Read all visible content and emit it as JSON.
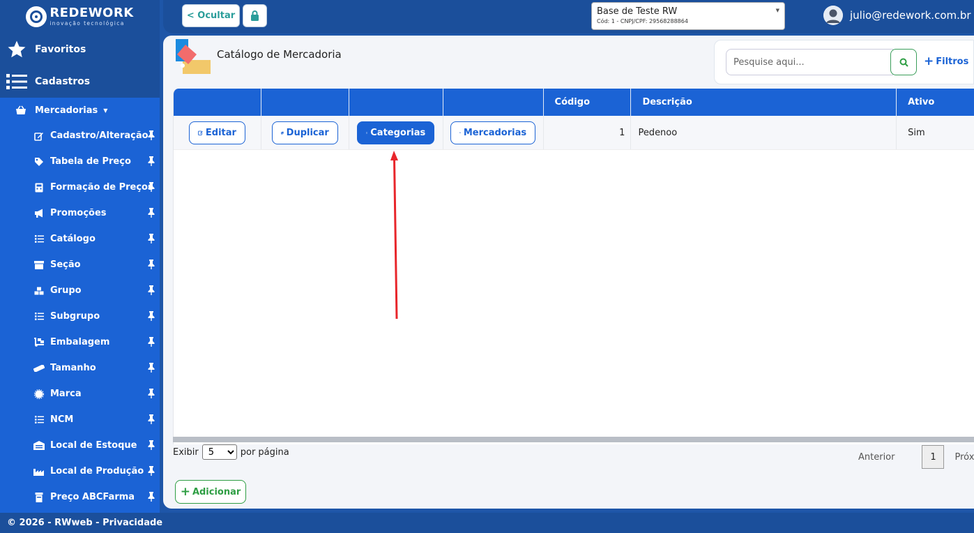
{
  "brand": {
    "name": "REDEWORK",
    "tagline": "inovação tecnológica"
  },
  "sidebar": {
    "main": [
      {
        "label": "Favoritos",
        "icon": "star-icon"
      },
      {
        "label": "Cadastros",
        "icon": "list-icon"
      }
    ],
    "group": {
      "label": "Mercadorias",
      "icon": "basket-icon"
    },
    "items": [
      {
        "label": "Cadastro/Alteração",
        "icon": "edit-icon"
      },
      {
        "label": "Tabela de Preço",
        "icon": "tag-icon"
      },
      {
        "label": "Formação de Preços",
        "icon": "calculator-icon"
      },
      {
        "label": "Promoções",
        "icon": "megaphone-icon"
      },
      {
        "label": "Catálogo",
        "icon": "list-icon"
      },
      {
        "label": "Seção",
        "icon": "archive-icon"
      },
      {
        "label": "Grupo",
        "icon": "cubes-icon"
      },
      {
        "label": "Subgrupo",
        "icon": "list-icon"
      },
      {
        "label": "Embalagem",
        "icon": "dolly-icon"
      },
      {
        "label": "Tamanho",
        "icon": "ruler-icon"
      },
      {
        "label": "Marca",
        "icon": "badge-icon"
      },
      {
        "label": "NCM",
        "icon": "list-icon"
      },
      {
        "label": "Local de Estoque",
        "icon": "warehouse-icon"
      },
      {
        "label": "Local de Produção",
        "icon": "industry-icon"
      },
      {
        "label": "Preço ABCFarma",
        "icon": "prescription-icon"
      }
    ]
  },
  "topbar": {
    "hide_label": "< Ocultar",
    "database": {
      "name": "Base de Teste RW",
      "code": "Cód: 1 - CNPJ/CPF: 29568288864"
    },
    "user_email": "julio@redework.com.br"
  },
  "page": {
    "title": "Catálogo de Mercadoria",
    "search_placeholder": "Pesquise aqui...",
    "filters_label": "Filtros"
  },
  "table": {
    "headers": [
      "",
      "",
      "",
      "",
      "Código",
      "Descrição",
      "Ativo"
    ],
    "actions": {
      "edit": "Editar",
      "duplicate": "Duplicar",
      "categories": "Categorias",
      "products": "Mercadorias"
    },
    "rows": [
      {
        "codigo": "1",
        "descricao": "Pedenoo",
        "ativo": "Sim"
      }
    ]
  },
  "pagination": {
    "show_label": "Exibir",
    "per_page_value": "5",
    "per_page_label": "por página",
    "prev": "Anterior",
    "current": "1",
    "next": "Próximo"
  },
  "add_label": "Adicionar",
  "footer": "© 2026 - RWweb - Privacidade",
  "colors": {
    "primary": "#1b63d5",
    "dark": "#1b4f9b",
    "success": "#2f9e44",
    "annotation": "#e8262b"
  }
}
